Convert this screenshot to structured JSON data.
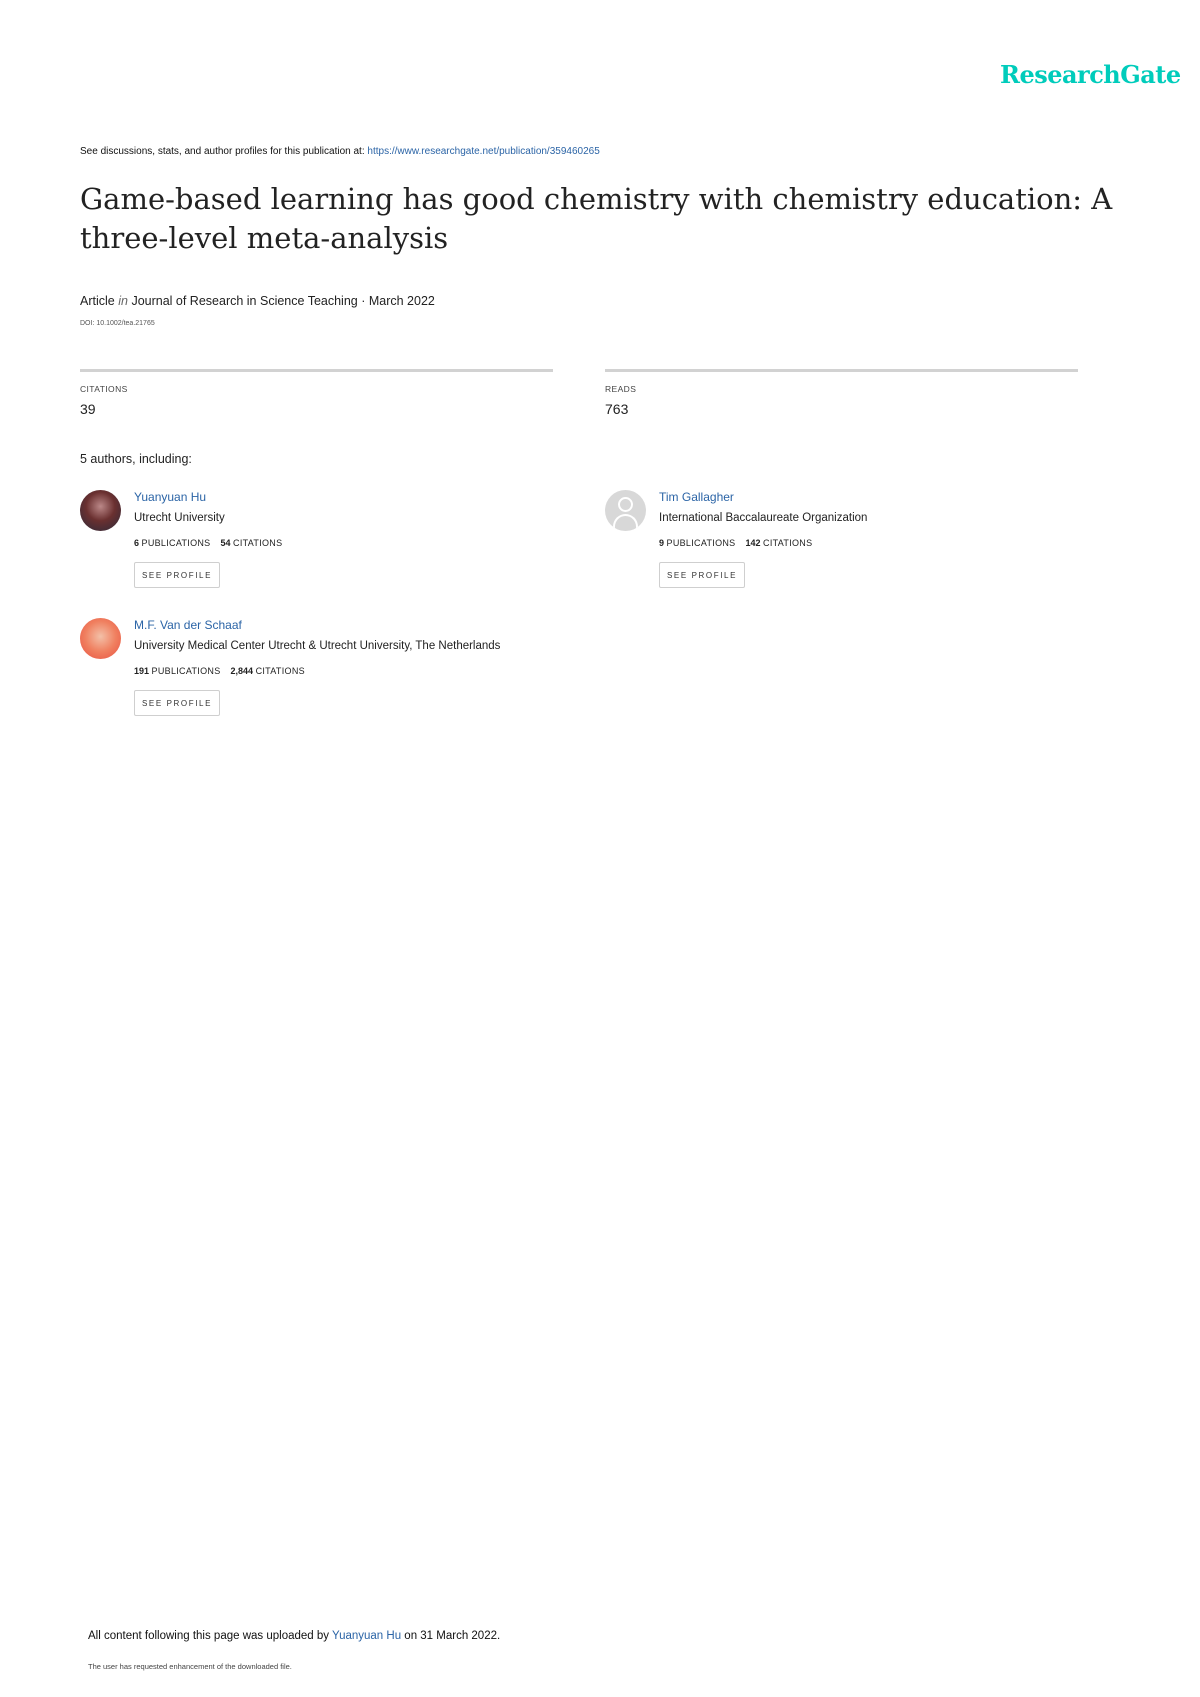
{
  "logo": "ResearchGate",
  "discussion": {
    "prefix": "See discussions, stats, and author profiles for this publication at:",
    "url": "https://www.researchgate.net/publication/359460265"
  },
  "title": "Game-based learning has good chemistry with chemistry education: A three-level meta-analysis",
  "article": {
    "type": "Article",
    "in": "in",
    "journal": "Journal of Research in Science Teaching · March 2022",
    "doi": "DOI: 10.1002/tea.21765"
  },
  "stats": {
    "citations_label": "CITATIONS",
    "citations_value": "39",
    "reads_label": "READS",
    "reads_value": "763"
  },
  "authors_heading": "5 authors, including:",
  "see_profile_label": "SEE PROFILE",
  "authors": [
    {
      "name": "Yuanyuan Hu",
      "institution": "Utrecht University",
      "publications": "6",
      "publications_label": "PUBLICATIONS",
      "citations": "54",
      "citations_label": "CITATIONS"
    },
    {
      "name": "Tim Gallagher",
      "institution": "International Baccalaureate Organization",
      "publications": "9",
      "publications_label": "PUBLICATIONS",
      "citations": "142",
      "citations_label": "CITATIONS"
    },
    {
      "name": "M.F. Van der Schaaf",
      "institution": "University Medical Center Utrecht & Utrecht University, The Netherlands",
      "publications": "191",
      "publications_label": "PUBLICATIONS",
      "citations": "2,844",
      "citations_label": "CITATIONS"
    }
  ],
  "footer": {
    "uploaded_prefix": "All content following this page was uploaded by",
    "uploader": "Yuanyuan Hu",
    "uploaded_suffix": "on 31 March 2022.",
    "note": "The user has requested enhancement of the downloaded file."
  }
}
